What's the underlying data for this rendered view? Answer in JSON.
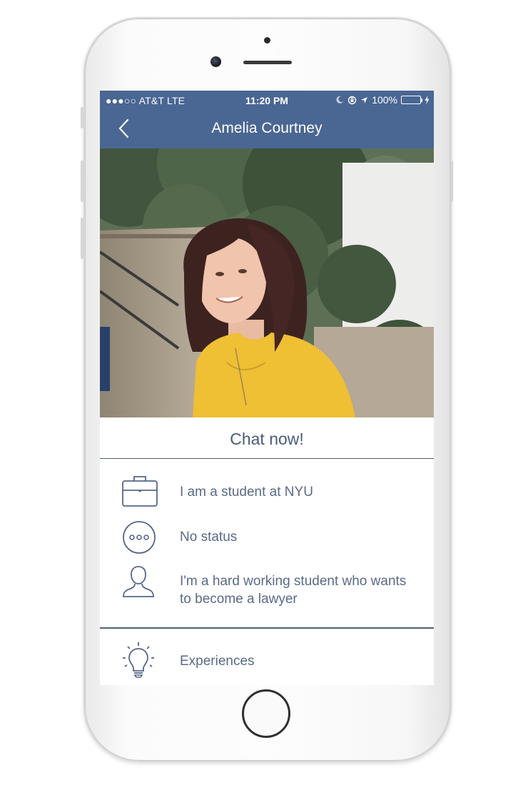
{
  "status_bar": {
    "carrier": "●●●○○ AT&T  LTE",
    "time": "11:20 PM",
    "battery": "100%"
  },
  "nav": {
    "title": "Amelia Courtney"
  },
  "chat_button": "Chat now!",
  "profile": {
    "occupation": "I am a student at NYU",
    "status": "No status",
    "bio_line1": "I'm a hard working student who wants",
    "bio_line2": "to become a lawyer",
    "experiences": "Experiences"
  },
  "colors": {
    "nav_bar": "#4a6693",
    "accent_text": "#4a5b7a",
    "battery": "#4cd964"
  }
}
